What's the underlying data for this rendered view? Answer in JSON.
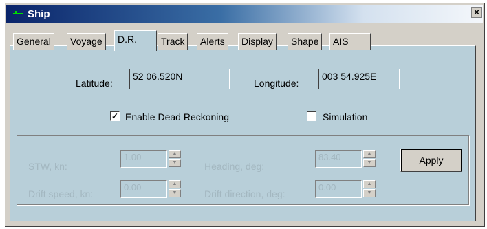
{
  "window": {
    "title": "Ship",
    "close_label": "×"
  },
  "tabs": [
    {
      "label": "General"
    },
    {
      "label": "Voyage"
    },
    {
      "label": "D.R.",
      "active": true
    },
    {
      "label": "Track"
    },
    {
      "label": "Alerts"
    },
    {
      "label": "Display"
    },
    {
      "label": "Shape"
    },
    {
      "label": "AIS"
    }
  ],
  "position": {
    "latitude_label": "Latitude:",
    "latitude_value": "52 06.520N",
    "longitude_label": "Longitude:",
    "longitude_value": "003 54.925E"
  },
  "options": {
    "dead_reckoning_label": "Enable Dead Reckoning",
    "dead_reckoning_checked": true,
    "simulation_label": "Simulation",
    "simulation_checked": false
  },
  "simulation_group": {
    "stw_label": "STW, kn:",
    "stw_value": "1.00",
    "heading_label": "Heading, deg:",
    "heading_value": "83.40",
    "drift_speed_label": "Drift speed, kn:",
    "drift_speed_value": "0.00",
    "drift_direction_label": "Drift direction, deg:",
    "drift_direction_value": "0.00",
    "apply_label": "Apply"
  },
  "colors": {
    "panel": "#b8cfd9",
    "chrome": "#d4d0c8",
    "disabled_text": "#a3b7c0",
    "title_bar": "#0a246a"
  }
}
